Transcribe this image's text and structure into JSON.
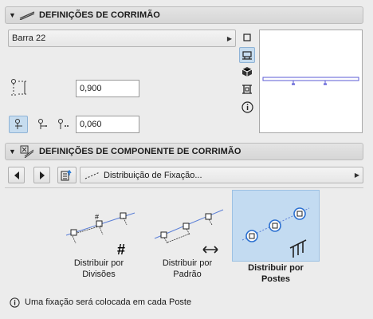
{
  "railing_settings": {
    "title": "DEFINIÇÕES DE CORRIMÃO",
    "profile_dropdown": "Barra 22",
    "height_value": "0,900",
    "offset_value": "0,060"
  },
  "component_settings": {
    "title": "DEFINIÇÕES DE COMPONENTE DE CORRIMÃO",
    "type_dropdown": "Distribuição de Fixação..."
  },
  "options": [
    {
      "label_line1": "Distribuir por",
      "label_line2": "Divisões",
      "selected": false
    },
    {
      "label_line1": "Distribuir por",
      "label_line2": "Padrão",
      "selected": false
    },
    {
      "label_line1": "Distribuir por",
      "label_line2": "Postes",
      "selected": true
    }
  ],
  "info_text": "Uma fixação será colocada em cada Poste",
  "colors": {
    "selection": "#c3dbf1",
    "preview_line": "#5b5bd6"
  }
}
